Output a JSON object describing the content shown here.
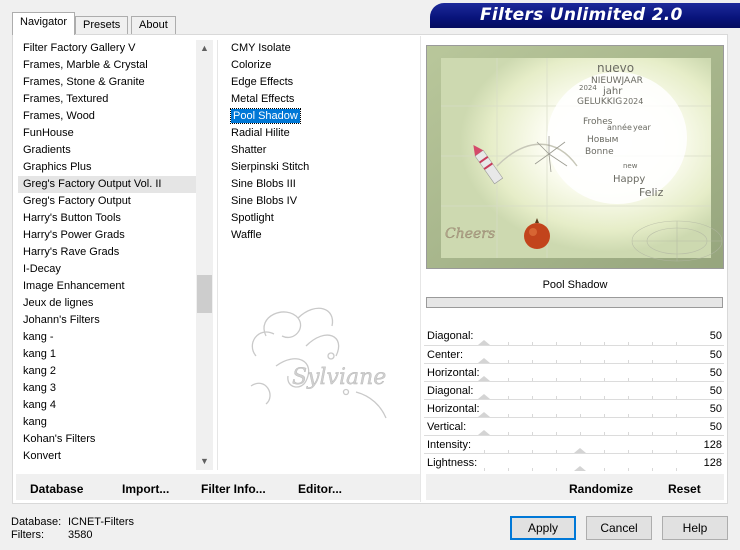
{
  "window": {
    "title": "Filters Unlimited 2.0"
  },
  "tabs": [
    {
      "label": "Navigator",
      "active": true
    },
    {
      "label": "Presets",
      "active": false
    },
    {
      "label": "About",
      "active": false
    }
  ],
  "categories": [
    "Filter Factory Gallery V",
    "Frames, Marble & Crystal",
    "Frames, Stone & Granite",
    "Frames, Textured",
    "Frames, Wood",
    "FunHouse",
    "Gradients",
    "Graphics Plus",
    "Greg's Factory Output Vol. II",
    "Greg's Factory Output",
    "Harry's Button Tools",
    "Harry's Power Grads",
    "Harry's Rave Grads",
    "I-Decay",
    "Image Enhancement",
    "Jeux de lignes",
    "Johann's Filters",
    "kang -",
    "kang 1",
    "kang 2",
    "kang 3",
    "kang 4",
    "kang",
    "Kohan's Filters",
    "Konvert"
  ],
  "selected_category": "Greg's Factory Output Vol. II",
  "filters": [
    "CMY Isolate",
    "Colorize",
    "Edge Effects",
    "Metal Effects",
    "Pool Shadow",
    "Radial Hilite",
    "Shatter",
    "Sierpinski Stitch",
    "Sine Blobs III",
    "Sine Blobs IV",
    "Spotlight",
    "Waffle"
  ],
  "selected_filter": "Pool Shadow",
  "watermark_text": "Sylviane",
  "preview": {
    "filter_name": "Pool Shadow",
    "wordcloud": [
      "nuevo",
      "NIEUWJAAR",
      "jahr",
      "2024",
      "GELUKKIG",
      "2024",
      "Frohes",
      "année",
      "year",
      "Новым",
      "Bonne",
      "Feliz",
      "Happy",
      "new",
      "Cheers"
    ]
  },
  "parameters": [
    {
      "label": "Diagonal:",
      "value": "50",
      "fraction": 0.0
    },
    {
      "label": "Center:",
      "value": "50",
      "fraction": 0.0
    },
    {
      "label": "Horizontal:",
      "value": "50",
      "fraction": 0.0
    },
    {
      "label": "Diagonal:",
      "value": "50",
      "fraction": 0.0
    },
    {
      "label": "Horizontal:",
      "value": "50",
      "fraction": 0.0
    },
    {
      "label": "Vertical:",
      "value": "50",
      "fraction": 0.0
    },
    {
      "label": "Intensity:",
      "value": "128",
      "fraction": 0.5
    },
    {
      "label": "Lightness:",
      "value": "128",
      "fraction": 0.5
    }
  ],
  "buttons": {
    "database": "Database",
    "import": "Import...",
    "filter_info": "Filter Info...",
    "editor": "Editor...",
    "randomize": "Randomize",
    "reset": "Reset",
    "apply": "Apply",
    "cancel": "Cancel",
    "help": "Help"
  },
  "status": {
    "database_label": "Database:",
    "database_value": "ICNET-Filters",
    "filters_label": "Filters:",
    "filters_value": "3580"
  },
  "colors": {
    "banner": "#08137a",
    "selection": "#0078d7",
    "default_button_border": "#0078d7"
  }
}
